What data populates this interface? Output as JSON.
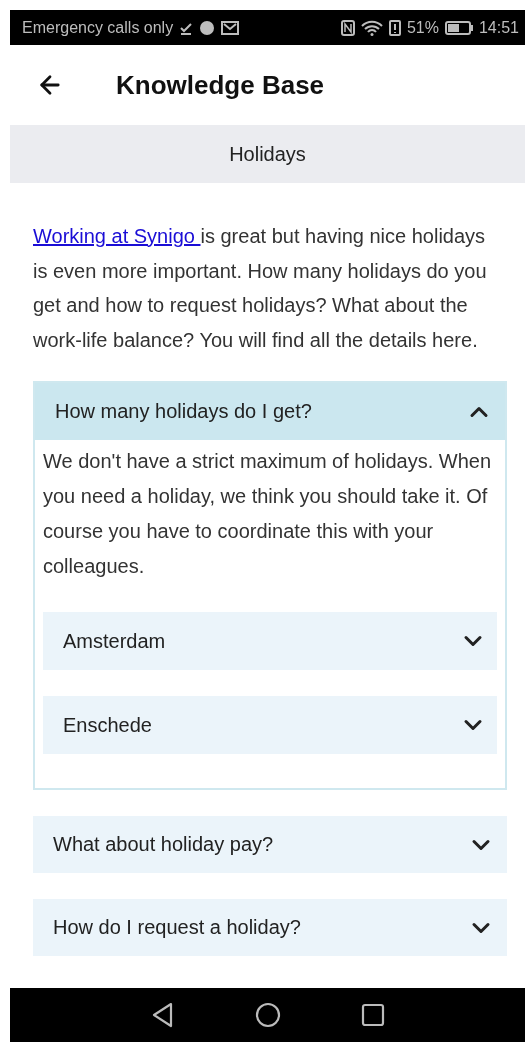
{
  "status_bar": {
    "carrier": "Emergency calls only",
    "battery": "51%",
    "time": "14:51"
  },
  "header": {
    "title": "Knowledge Base"
  },
  "section": {
    "title": "Holidays"
  },
  "intro": {
    "link": "Working at Synigo ",
    "text": "is great but having nice holidays is even more important. How many holidays do you get and how to request holidays? What about the work-life balance? You will find all the details here."
  },
  "faq": [
    {
      "question": "How many holidays do I get?",
      "expanded": true,
      "answer": "We don't have a strict maximum of holidays. When you need a holiday, we think you should take it. Of course you have to coordinate this with your colleagues.",
      "children": [
        {
          "label": "Amsterdam",
          "expanded": false
        },
        {
          "label": "Enschede",
          "expanded": false
        }
      ]
    },
    {
      "question": "What about holiday pay?",
      "expanded": false
    },
    {
      "question": "How do I request a holiday?",
      "expanded": false
    }
  ]
}
